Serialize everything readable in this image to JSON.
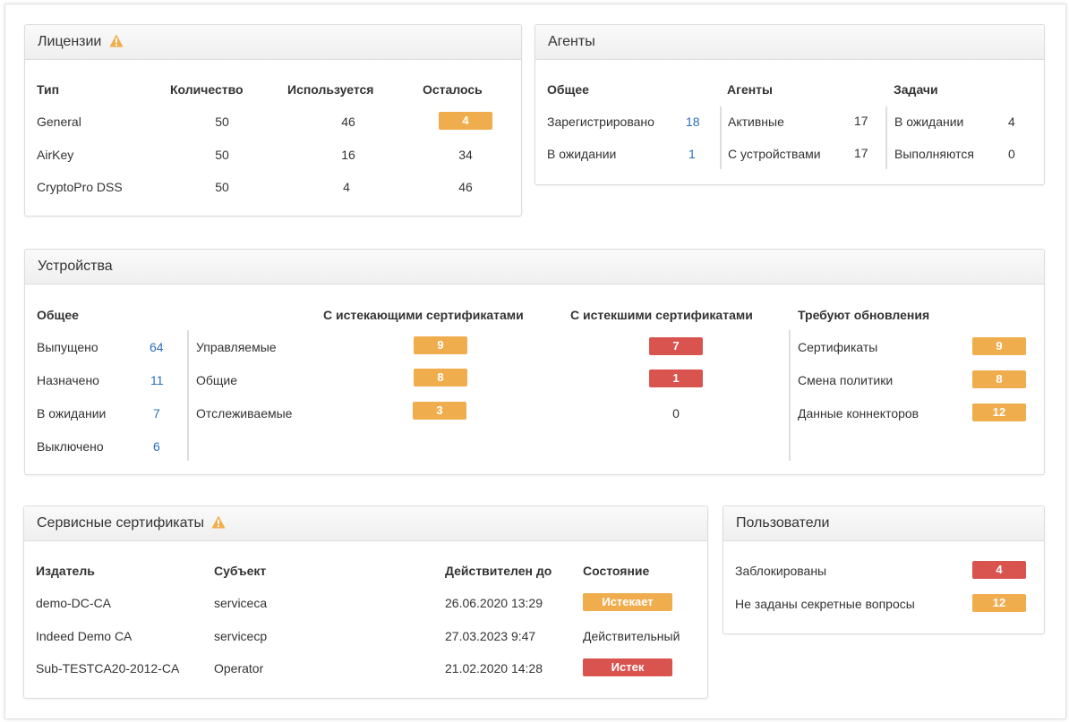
{
  "licenses": {
    "title": "Лицензии",
    "headers": [
      "Тип",
      "Количество",
      "Используется",
      "Осталось"
    ],
    "rows": [
      {
        "type": "General",
        "count": "50",
        "used": "46",
        "left": "4",
        "left_badge": "orange"
      },
      {
        "type": "AirKey",
        "count": "50",
        "used": "16",
        "left": "34"
      },
      {
        "type": "CryptoPro DSS",
        "count": "50",
        "used": "4",
        "left": "46"
      }
    ]
  },
  "agents": {
    "title": "Агенты",
    "general": {
      "header": "Общее",
      "registered_label": "Зарегистрировано",
      "registered_value": "18",
      "pending_label": "В ожидании",
      "pending_value": "1"
    },
    "agents": {
      "header": "Агенты",
      "active_label": "Активные",
      "active_value": "17",
      "devices_label": "С устройствами",
      "devices_value": "17"
    },
    "tasks": {
      "header": "Задачи",
      "pending_label": "В ожидании",
      "pending_value": "4",
      "running_label": "Выполняются",
      "running_value": "0"
    }
  },
  "devices": {
    "title": "Устройства",
    "general": {
      "header": "Общее",
      "items": [
        {
          "label": "Выпущено",
          "value": "64"
        },
        {
          "label": "Назначено",
          "value": "11"
        },
        {
          "label": "В ожидании",
          "value": "7"
        },
        {
          "label": "Выключено",
          "value": "6"
        }
      ]
    },
    "expiring_header": "С истекающими сертификатами",
    "expired_header": "С истекшими сертификатами",
    "rows": [
      {
        "label": "Управляемые",
        "expiring": "9",
        "expired": "7"
      },
      {
        "label": "Общие",
        "expiring": "8",
        "expired": "1"
      },
      {
        "label": "Отслеживаемые",
        "expiring": "3",
        "expired": "0"
      }
    ],
    "updates": {
      "header": "Требуют обновления",
      "items": [
        {
          "label": "Сертификаты",
          "value": "9"
        },
        {
          "label": "Смена политики",
          "value": "8"
        },
        {
          "label": "Данные коннекторов",
          "value": "12"
        }
      ]
    }
  },
  "service_certs": {
    "title": "Сервисные сертификаты",
    "headers": [
      "Издатель",
      "Субъект",
      "Действителен до",
      "Состояние"
    ],
    "rows": [
      {
        "issuer": "demo-DC-CA",
        "subject": "serviceca",
        "valid_to": "26.06.2020 13:29",
        "state": "Истекает",
        "state_badge": "orange"
      },
      {
        "issuer": "Indeed Demo CA",
        "subject": "servicecp",
        "valid_to": "27.03.2023 9:47",
        "state": "Действительный"
      },
      {
        "issuer": "Sub-TESTCA20-2012-CA",
        "subject": "Operator",
        "valid_to": "21.02.2020 14:28",
        "state": "Истек",
        "state_badge": "red"
      }
    ]
  },
  "users": {
    "title": "Пользователи",
    "items": [
      {
        "label": "Заблокированы",
        "value": "4"
      },
      {
        "label": "Не заданы секретные вопросы",
        "value": "12"
      }
    ]
  },
  "colors": {
    "orange": "#f0ad4e",
    "red": "#d9534f",
    "link": "#2a6ebb"
  }
}
